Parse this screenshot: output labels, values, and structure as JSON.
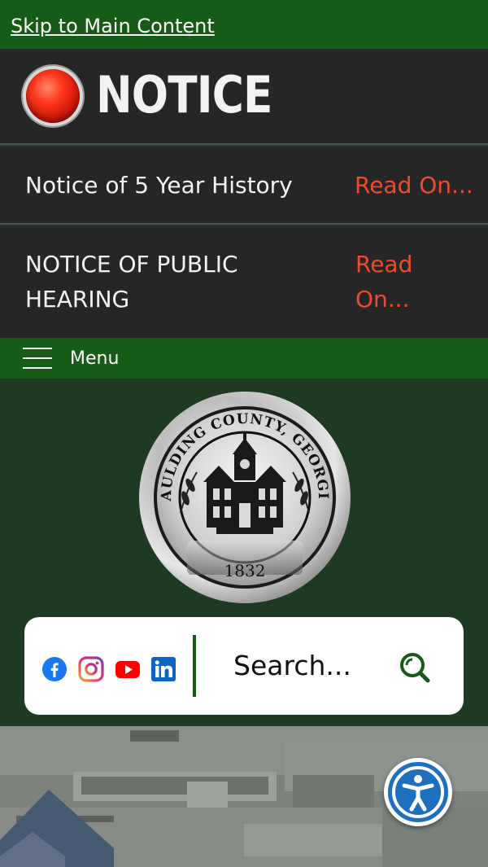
{
  "skip_link": "Skip to Main Content",
  "notice": {
    "title": "NOTICE",
    "items": [
      {
        "text": "Notice of 5 Year History",
        "link": "Read On..."
      },
      {
        "text": "NOTICE OF PUBLIC HEARING",
        "link": "Read On..."
      }
    ]
  },
  "menu": {
    "label": "Menu"
  },
  "seal": {
    "text_top": "PAULDING COUNTY, GEORGIA",
    "year": "1832"
  },
  "search": {
    "placeholder": "Search...",
    "social": [
      "facebook-icon",
      "instagram-icon",
      "youtube-icon",
      "linkedin-icon"
    ]
  },
  "colors": {
    "green": "#175c16",
    "dark_bg": "#262626",
    "link_red": "#ef4b2c",
    "page_bg": "#1e3a22",
    "a11y_blue": "#1f6fbf"
  }
}
